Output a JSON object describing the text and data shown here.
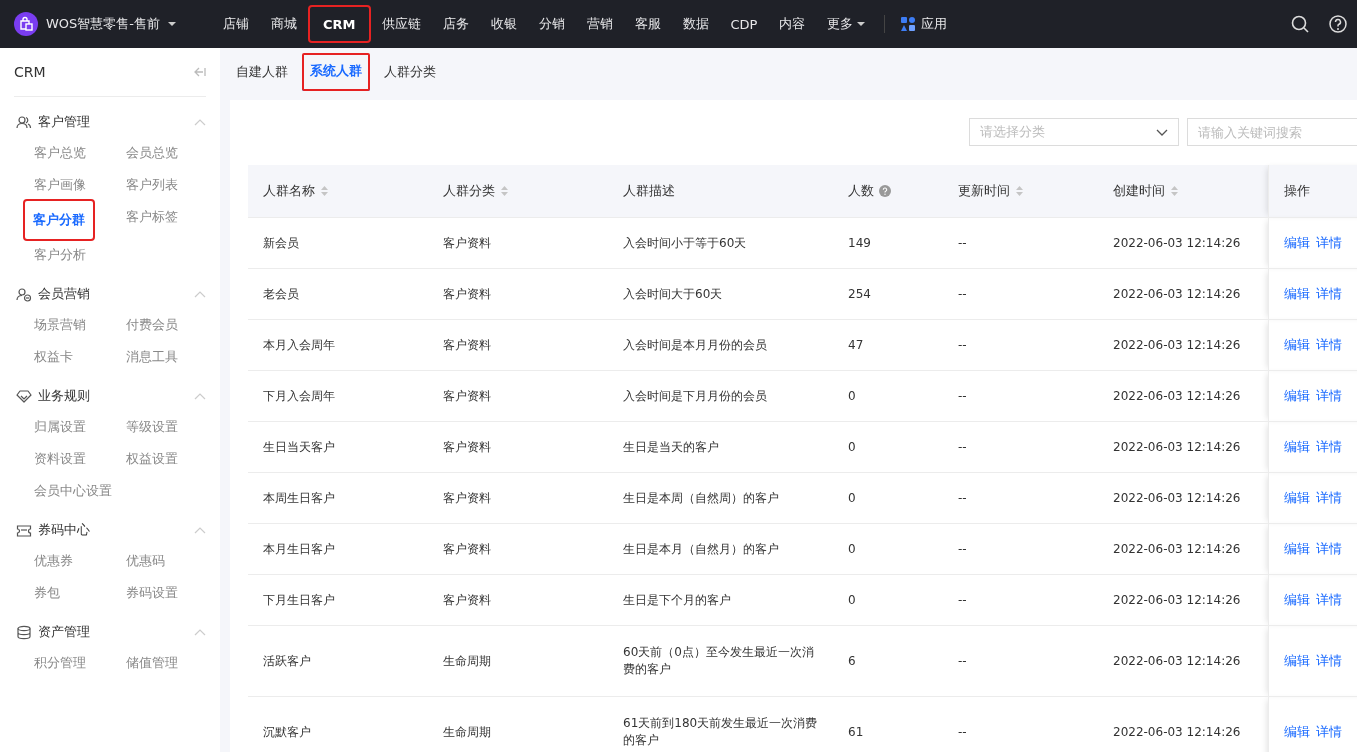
{
  "topbar": {
    "brand": "WOS智慧零售-售前",
    "nav": [
      {
        "label": "店铺",
        "selected": false,
        "highlighted": false,
        "kind": "link"
      },
      {
        "label": "商城",
        "selected": false,
        "highlighted": false,
        "kind": "link"
      },
      {
        "label": "CRM",
        "selected": true,
        "highlighted": true,
        "kind": "link"
      },
      {
        "label": "供应链",
        "selected": false,
        "highlighted": false,
        "kind": "link"
      },
      {
        "label": "店务",
        "selected": false,
        "highlighted": false,
        "kind": "link"
      },
      {
        "label": "收银",
        "selected": false,
        "highlighted": false,
        "kind": "link"
      },
      {
        "label": "分销",
        "selected": false,
        "highlighted": false,
        "kind": "link"
      },
      {
        "label": "营销",
        "selected": false,
        "highlighted": false,
        "kind": "link"
      },
      {
        "label": "客服",
        "selected": false,
        "highlighted": false,
        "kind": "link"
      },
      {
        "label": "数据",
        "selected": false,
        "highlighted": false,
        "kind": "link"
      },
      {
        "label": "CDP",
        "selected": false,
        "highlighted": false,
        "kind": "link"
      },
      {
        "label": "内容",
        "selected": false,
        "highlighted": false,
        "kind": "link"
      },
      {
        "label": "更多",
        "selected": false,
        "highlighted": false,
        "kind": "dropdown"
      }
    ],
    "apps": "应用"
  },
  "sidebar": {
    "title": "CRM",
    "groups": [
      {
        "title": "客户管理",
        "kind": "users",
        "expanded": true,
        "items": [
          {
            "label": "客户总览",
            "selected": false,
            "highlighted": false
          },
          {
            "label": "会员总览",
            "selected": false,
            "highlighted": false
          },
          {
            "label": "客户画像",
            "selected": false,
            "highlighted": false
          },
          {
            "label": "客户列表",
            "selected": false,
            "highlighted": false
          },
          {
            "label": "客户分群",
            "selected": true,
            "highlighted": true
          },
          {
            "label": "客户标签",
            "selected": false,
            "highlighted": false
          },
          {
            "label": "客户分析",
            "selected": false,
            "highlighted": false
          }
        ]
      },
      {
        "title": "会员营销",
        "kind": "member",
        "expanded": true,
        "items": [
          {
            "label": "场景营销",
            "selected": false,
            "highlighted": false
          },
          {
            "label": "付费会员",
            "selected": false,
            "highlighted": false
          },
          {
            "label": "权益卡",
            "selected": false,
            "highlighted": false
          },
          {
            "label": "消息工具",
            "selected": false,
            "highlighted": false
          }
        ]
      },
      {
        "title": "业务规则",
        "kind": "diamond",
        "expanded": true,
        "items": [
          {
            "label": "归属设置",
            "selected": false,
            "highlighted": false
          },
          {
            "label": "等级设置",
            "selected": false,
            "highlighted": false
          },
          {
            "label": "资料设置",
            "selected": false,
            "highlighted": false
          },
          {
            "label": "权益设置",
            "selected": false,
            "highlighted": false
          },
          {
            "label": "会员中心设置",
            "selected": false,
            "highlighted": false
          }
        ]
      },
      {
        "title": "券码中心",
        "kind": "ticket",
        "expanded": true,
        "items": [
          {
            "label": "优惠券",
            "selected": false,
            "highlighted": false
          },
          {
            "label": "优惠码",
            "selected": false,
            "highlighted": false
          },
          {
            "label": "券包",
            "selected": false,
            "highlighted": false
          },
          {
            "label": "券码设置",
            "selected": false,
            "highlighted": false
          }
        ]
      },
      {
        "title": "资产管理",
        "kind": "coins",
        "expanded": true,
        "items": [
          {
            "label": "积分管理",
            "selected": false,
            "highlighted": false
          },
          {
            "label": "储值管理",
            "selected": false,
            "highlighted": false
          }
        ]
      }
    ]
  },
  "tabs": [
    {
      "label": "自建人群",
      "selected": false,
      "highlighted": false
    },
    {
      "label": "系统人群",
      "selected": true,
      "highlighted": true
    },
    {
      "label": "人群分类",
      "selected": false,
      "highlighted": false
    }
  ],
  "filters": {
    "category": {
      "placeholder": "请选择分类"
    },
    "search": {
      "placeholder": "请输入关键词搜索"
    }
  },
  "table": {
    "columns": [
      {
        "label": "人群名称",
        "sortable": true,
        "help": false
      },
      {
        "label": "人群分类",
        "sortable": true,
        "help": false
      },
      {
        "label": "人群描述",
        "sortable": false,
        "help": false
      },
      {
        "label": "人数",
        "sortable": false,
        "help": true
      },
      {
        "label": "更新时间",
        "sortable": true,
        "help": false
      },
      {
        "label": "创建时间",
        "sortable": true,
        "help": false
      },
      {
        "label": "操作",
        "sortable": false,
        "help": false
      }
    ],
    "rows": [
      {
        "cells": [
          "新会员",
          "客户资料",
          "入会时间小于等于60天",
          "149",
          "--",
          "2022-06-03 12:14:26"
        ],
        "actions": [
          "编辑",
          "详情"
        ]
      },
      {
        "cells": [
          "老会员",
          "客户资料",
          "入会时间大于60天",
          "254",
          "--",
          "2022-06-03 12:14:26"
        ],
        "actions": [
          "编辑",
          "详情"
        ]
      },
      {
        "cells": [
          "本月入会周年",
          "客户资料",
          "入会时间是本月月份的会员",
          "47",
          "--",
          "2022-06-03 12:14:26"
        ],
        "actions": [
          "编辑",
          "详情"
        ]
      },
      {
        "cells": [
          "下月入会周年",
          "客户资料",
          "入会时间是下月月份的会员",
          "0",
          "--",
          "2022-06-03 12:14:26"
        ],
        "actions": [
          "编辑",
          "详情"
        ]
      },
      {
        "cells": [
          "生日当天客户",
          "客户资料",
          "生日是当天的客户",
          "0",
          "--",
          "2022-06-03 12:14:26"
        ],
        "actions": [
          "编辑",
          "详情"
        ]
      },
      {
        "cells": [
          "本周生日客户",
          "客户资料",
          "生日是本周（自然周）的客户",
          "0",
          "--",
          "2022-06-03 12:14:26"
        ],
        "actions": [
          "编辑",
          "详情"
        ]
      },
      {
        "cells": [
          "本月生日客户",
          "客户资料",
          "生日是本月（自然月）的客户",
          "0",
          "--",
          "2022-06-03 12:14:26"
        ],
        "actions": [
          "编辑",
          "详情"
        ]
      },
      {
        "cells": [
          "下月生日客户",
          "客户资料",
          "生日是下个月的客户",
          "0",
          "--",
          "2022-06-03 12:14:26"
        ],
        "actions": [
          "编辑",
          "详情"
        ]
      },
      {
        "cells": [
          "活跃客户",
          "生命周期",
          "60天前（0点）至今发生最近一次消费的客户",
          "6",
          "--",
          "2022-06-03 12:14:26"
        ],
        "actions": [
          "编辑",
          "详情"
        ]
      },
      {
        "cells": [
          "沉默客户",
          "生命周期",
          "61天前到180天前发生最近一次消费的客户",
          "61",
          "--",
          "2022-06-03 12:14:26"
        ],
        "actions": [
          "编辑",
          "详情"
        ]
      }
    ]
  }
}
